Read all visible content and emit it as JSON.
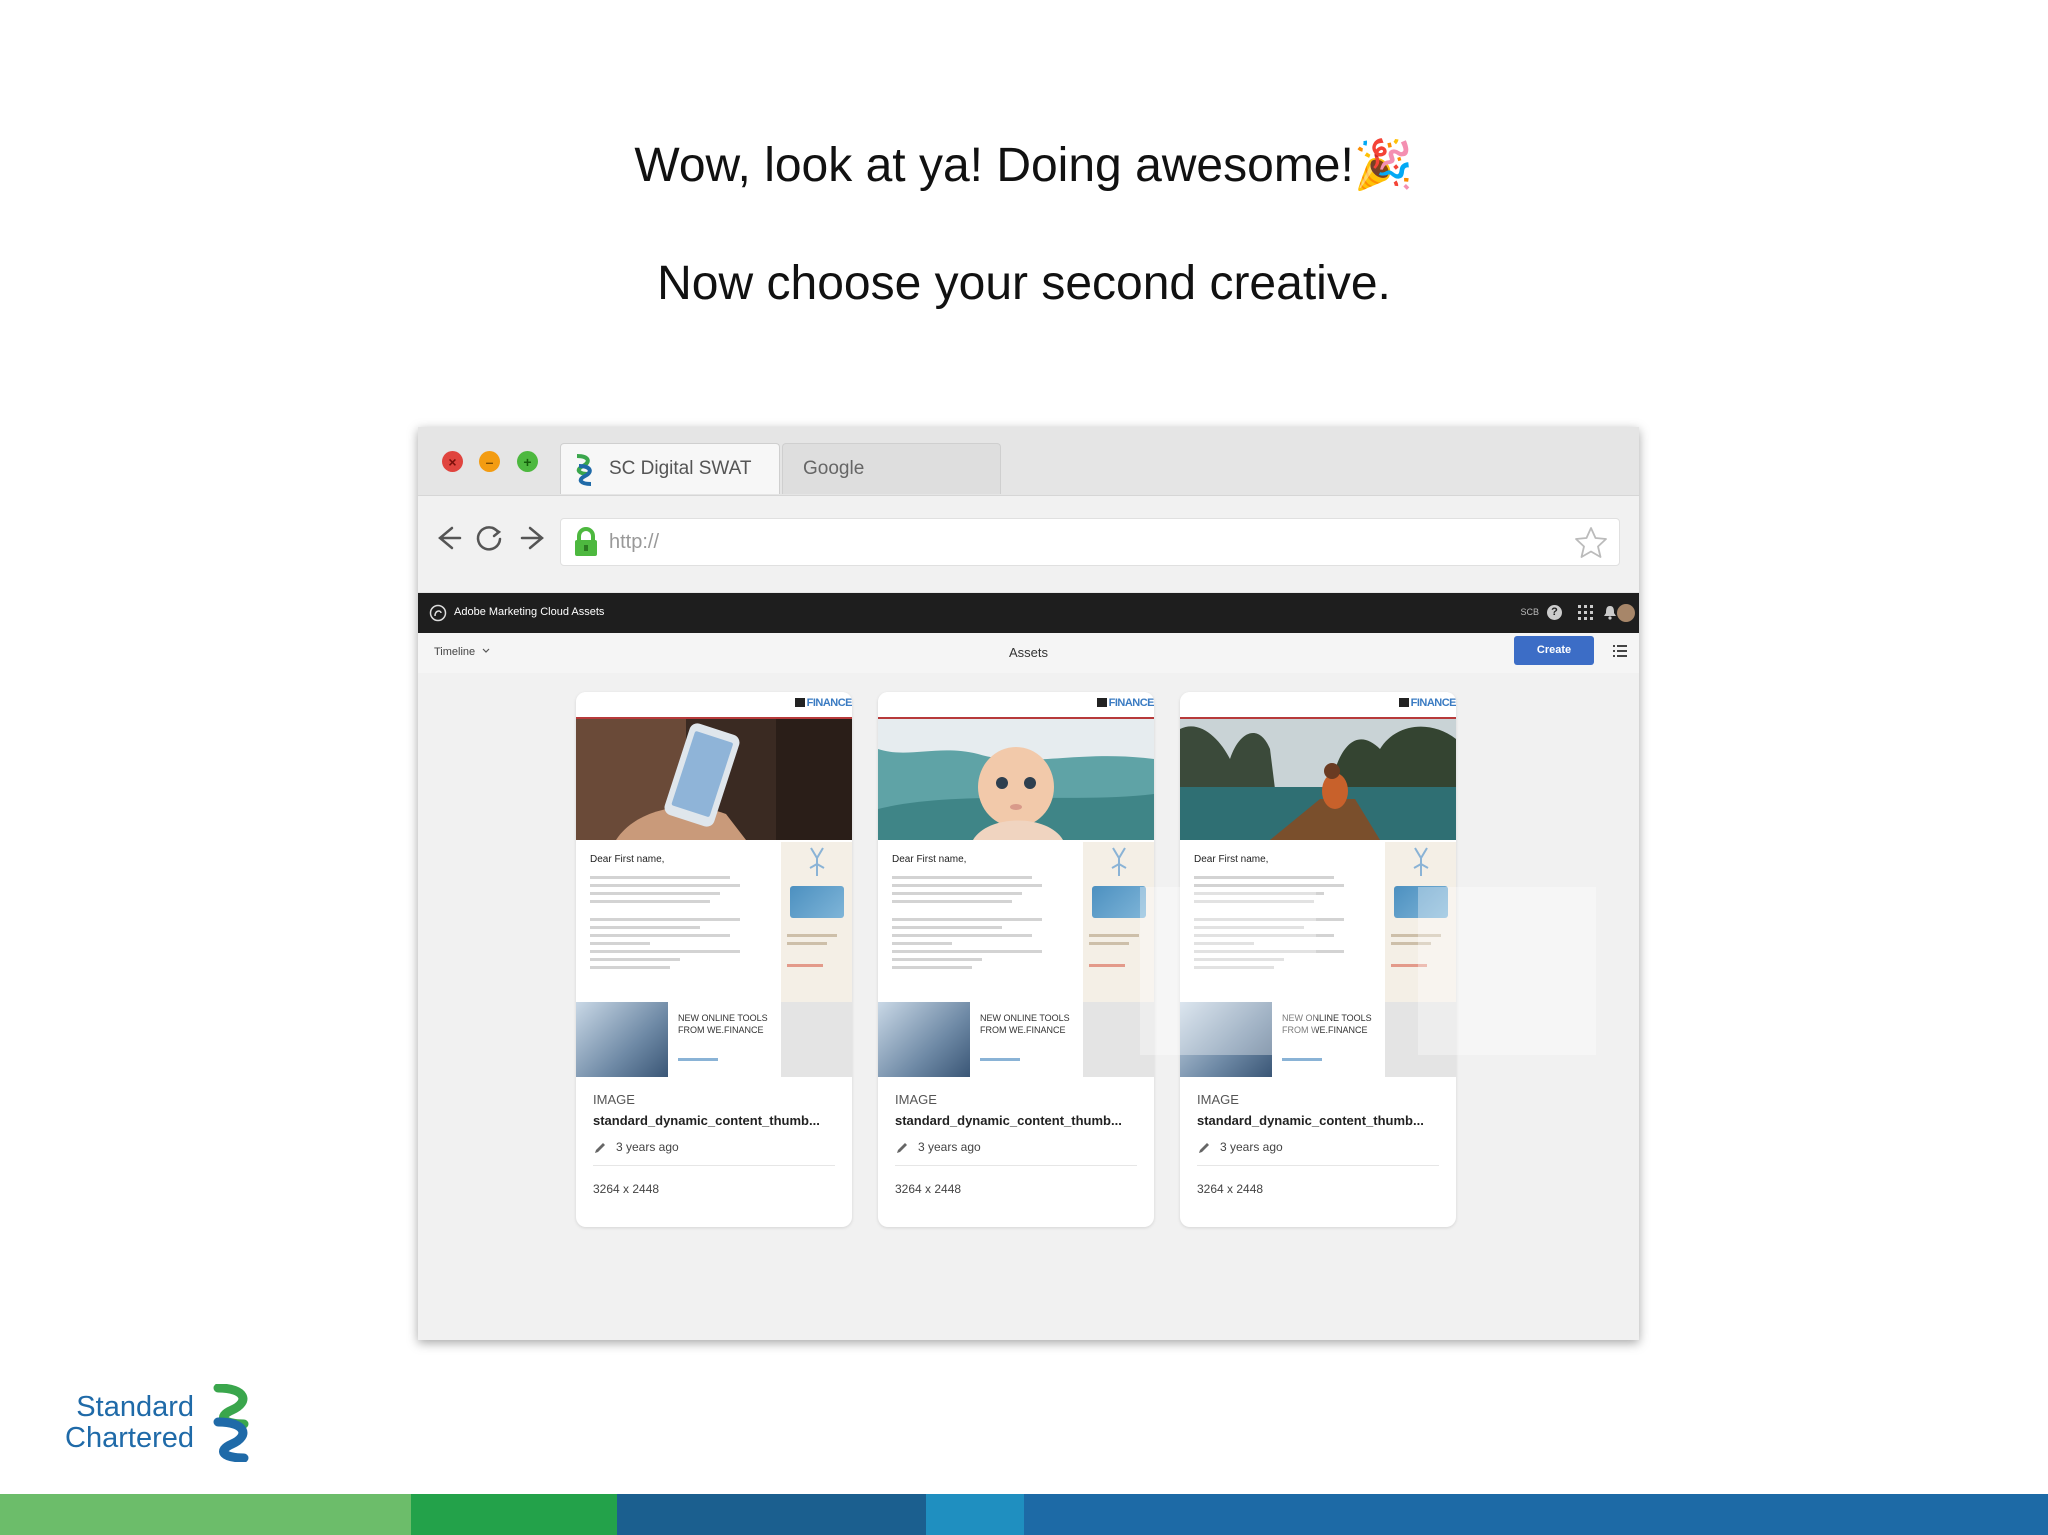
{
  "headline": {
    "line1": "Wow, look at ya! Doing awesome!",
    "line1_emoji": "🎉",
    "line2": "Now choose your second creative."
  },
  "browser": {
    "tabs": [
      {
        "label": "SC Digital SWAT",
        "active": true
      },
      {
        "label": "Google",
        "active": false
      }
    ],
    "address": "http://"
  },
  "app": {
    "title": "Adobe Marketing Cloud Assets",
    "header_org": "SCB",
    "header_help": "?",
    "view_selector": "Timeline",
    "page_title": "Assets",
    "create_label": "Create"
  },
  "cards": [
    {
      "brand": "FINANCE",
      "greeting": "Dear First name,",
      "promo_heading": "NEW ONLINE TOOLS FROM WE.FINANCE",
      "type": "IMAGE",
      "filename": "standard_dynamic_content_thumb...",
      "modified": "3 years ago",
      "dimensions": "3264 x 2448",
      "photo_subject": "hand holding smartphone"
    },
    {
      "brand": "FINANCE",
      "greeting": "Dear First name,",
      "promo_heading": "NEW ONLINE TOOLS FROM WE.FINANCE",
      "type": "IMAGE",
      "filename": "standard_dynamic_content_thumb...",
      "modified": "3 years ago",
      "dimensions": "3264 x 2448",
      "photo_subject": "baby on blanket"
    },
    {
      "brand": "FINANCE",
      "greeting": "Dear First name,",
      "promo_heading": "NEW ONLINE TOOLS FROM WE.FINANCE",
      "type": "IMAGE",
      "filename": "standard_dynamic_content_thumb...",
      "modified": "3 years ago",
      "dimensions": "3264 x 2448",
      "photo_subject": "woman in boat among limestone cliffs"
    }
  ],
  "footer": {
    "logo_line1": "Standard",
    "logo_line2": "Chartered"
  },
  "colors": {
    "brand_blue": "#1f6aa8",
    "brand_green": "#3aa64c",
    "create_button": "#3c6dc6",
    "stripe": [
      "#6cbd6a",
      "#23a24a",
      "#1b5f8f",
      "#1f8fc0",
      "#1d6aa6"
    ]
  },
  "icons": [
    "close-icon",
    "minimize-icon",
    "maximize-icon",
    "back-icon",
    "reload-icon",
    "forward-icon",
    "lock-icon",
    "star-icon",
    "help-icon",
    "apps-grid-icon",
    "bell-icon",
    "list-view-icon",
    "pencil-icon",
    "chevron-down-icon"
  ]
}
